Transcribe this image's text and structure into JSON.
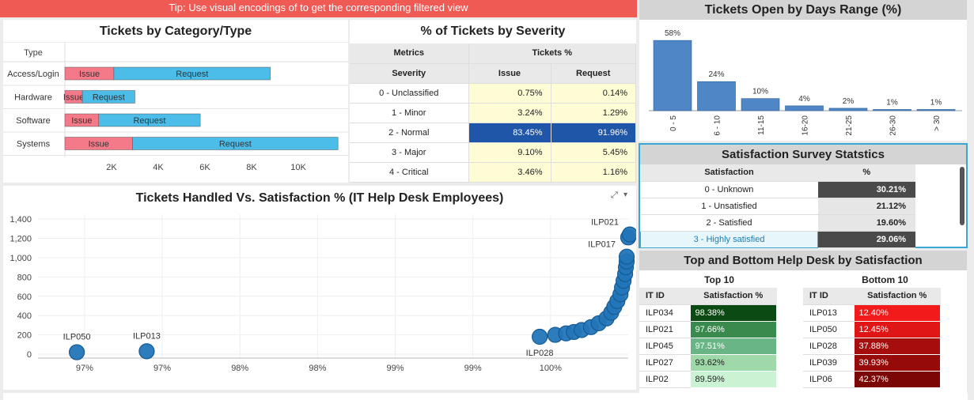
{
  "tip": "Tip: Use visual encodings of to get the corresponding filtered view",
  "category_panel": {
    "title": "Tickets by Category/Type",
    "header": "Type",
    "colors": {
      "issue": "#f47a8a",
      "request": "#4bbde8"
    },
    "chart_data": {
      "type": "bar",
      "stacked": true,
      "orientation": "horizontal",
      "categories": [
        "Access/Login",
        "Hardware",
        "Software",
        "Systems"
      ],
      "series": [
        {
          "name": "Issue",
          "values": [
            2100,
            750,
            1450,
            2900
          ]
        },
        {
          "name": "Request",
          "values": [
            6700,
            2250,
            4350,
            8800
          ]
        }
      ],
      "xticks": [
        "2K",
        "4K",
        "6K",
        "8K",
        "10K"
      ],
      "xtick_values": [
        2000,
        4000,
        6000,
        8000,
        10000
      ],
      "xlim": [
        0,
        12000
      ]
    }
  },
  "severity_panel": {
    "title": "% of Tickets by Severity",
    "headers": {
      "metrics": "Metrics",
      "tickets": "Tickets %",
      "severity": "Severity",
      "issue": "Issue",
      "request": "Request"
    },
    "rows": [
      {
        "label": "0 - Unclassified",
        "issue": "0.75%",
        "request": "0.14%"
      },
      {
        "label": "1 - Minor",
        "issue": "3.24%",
        "request": "1.29%"
      },
      {
        "label": "2 - Normal",
        "issue": "83.45%",
        "request": "91.96%"
      },
      {
        "label": "3 - Major",
        "issue": "9.10%",
        "request": "5.45%"
      },
      {
        "label": "4 - Critical",
        "issue": "3.46%",
        "request": "1.16%"
      }
    ]
  },
  "days_panel": {
    "title": "Tickets Open by Days Range (%)",
    "color": "#4f86c6",
    "chart_data": {
      "type": "bar",
      "categories": [
        "0 - 5",
        "6 - 10",
        "11-15",
        "16-20",
        "21-25",
        "26-30",
        "> 30"
      ],
      "values": [
        58,
        24,
        10,
        4,
        2,
        1,
        1
      ],
      "labels": [
        "58%",
        "24%",
        "10%",
        "4%",
        "2%",
        "1%",
        "1%"
      ],
      "ylim": [
        0,
        62
      ]
    }
  },
  "scatter_panel": {
    "title": "Tickets Handled Vs. Satisfaction % (IT Help Desk Employees)",
    "expand_glyph": "⤢",
    "menu_glyph": "▾",
    "color": "#2275b8",
    "chart_data": {
      "type": "scatter",
      "yticks": [
        "1,400",
        "1,200",
        "1,000",
        "800",
        "600",
        "400",
        "200",
        "0"
      ],
      "ytick_values": [
        1400,
        1200,
        1000,
        800,
        600,
        400,
        200,
        0
      ],
      "xticks": [
        "97%",
        "97%",
        "98%",
        "98%",
        "99%",
        "99%",
        "100%"
      ],
      "xtick_values": [
        96.9,
        97.4,
        97.9,
        98.4,
        98.9,
        99.4,
        99.9
      ],
      "xlim": [
        96.6,
        100.4
      ],
      "ylim": [
        0,
        1450
      ],
      "points": [
        {
          "x": 96.85,
          "y": 20,
          "label": "ILP050"
        },
        {
          "x": 97.3,
          "y": 30,
          "label": "ILP013"
        },
        {
          "x": 99.83,
          "y": 180,
          "label": "ILP028"
        },
        {
          "x": 99.93,
          "y": 200
        },
        {
          "x": 100.0,
          "y": 215
        },
        {
          "x": 100.05,
          "y": 230
        },
        {
          "x": 100.1,
          "y": 250
        },
        {
          "x": 100.16,
          "y": 280
        },
        {
          "x": 100.21,
          "y": 320
        },
        {
          "x": 100.26,
          "y": 370
        },
        {
          "x": 100.29,
          "y": 430
        },
        {
          "x": 100.31,
          "y": 490
        },
        {
          "x": 100.33,
          "y": 550
        },
        {
          "x": 100.35,
          "y": 620
        },
        {
          "x": 100.36,
          "y": 690
        },
        {
          "x": 100.37,
          "y": 760
        },
        {
          "x": 100.38,
          "y": 830
        },
        {
          "x": 100.385,
          "y": 900
        },
        {
          "x": 100.39,
          "y": 960
        },
        {
          "x": 100.39,
          "y": 1010,
          "label": "ILP017"
        },
        {
          "x": 100.4,
          "y": 1210
        },
        {
          "x": 100.41,
          "y": 1240,
          "label": "ILP021"
        }
      ]
    }
  },
  "survey_panel": {
    "title": "Satisfaction Survey Statstics",
    "headers": {
      "satisfaction": "Satisfaction",
      "pct": "%"
    },
    "rows": [
      {
        "label": "0 - Unknown",
        "pct": "30.21%"
      },
      {
        "label": "1 - Unsatisfied",
        "pct": "21.12%"
      },
      {
        "label": "2 - Satisfied",
        "pct": "19.60%"
      },
      {
        "label": "3 - Highly satisfied",
        "pct": "29.06%"
      }
    ]
  },
  "topbottom_panel": {
    "title": "Top and Bottom Help Desk by Satisfaction",
    "top": {
      "heading": "Top 10",
      "headers": {
        "id": "IT ID",
        "pct": "Satisfaction %"
      },
      "rows": [
        {
          "id": "ILP034",
          "pct": "98.38%",
          "color": "#0b4a12"
        },
        {
          "id": "ILP021",
          "pct": "97.66%",
          "color": "#3a8a4e"
        },
        {
          "id": "ILP045",
          "pct": "97.51%",
          "color": "#6ab586"
        },
        {
          "id": "ILP027",
          "pct": "93.62%",
          "color": "#9fd9a9"
        },
        {
          "id": "ILP02",
          "pct": "89.59%",
          "color": "#cbf3d3"
        }
      ]
    },
    "bottom": {
      "heading": "Bottom 10",
      "headers": {
        "id": "IT ID",
        "pct": "Satisfaction %"
      },
      "rows": [
        {
          "id": "ILP013",
          "pct": "12.40%",
          "color": "#f21a1a"
        },
        {
          "id": "ILP050",
          "pct": "12.45%",
          "color": "#e01515"
        },
        {
          "id": "ILP028",
          "pct": "37.88%",
          "color": "#a60e0e"
        },
        {
          "id": "ILP039",
          "pct": "39.93%",
          "color": "#960a0a"
        },
        {
          "id": "ILP06",
          "pct": "42.37%",
          "color": "#7a0606"
        }
      ]
    }
  }
}
